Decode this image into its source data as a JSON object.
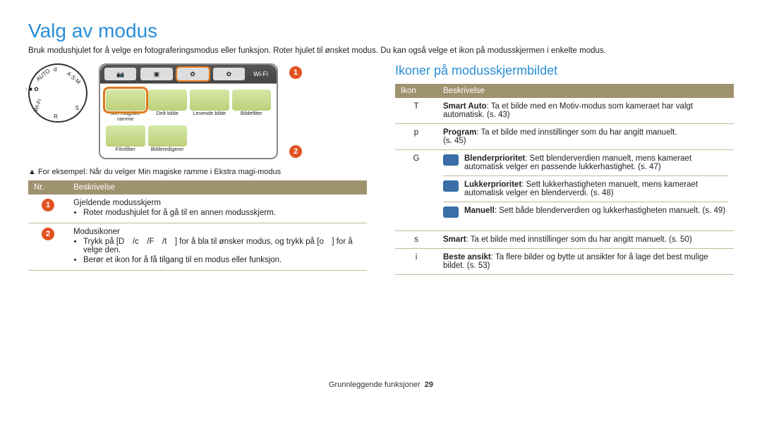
{
  "page": {
    "title": "Valg av modus",
    "intro": "Bruk modushjulet for å velge en fotograferingsmodus eller funksjon. Roter hjulet til ønsket modus. Du kan også velge et ikon på modusskjermen i enkelte modus.",
    "example": "▲ For eksempel: Når du velger Min magiske ramme i Ekstra magi-modus",
    "footer_section": "Grunnleggende funksjoner",
    "footer_page": "29"
  },
  "mode_panel": {
    "wifi": "Wi-Fi",
    "thumbs": [
      {
        "label": "Min magiske ramme",
        "selected": true
      },
      {
        "label": "Delt bilde"
      },
      {
        "label": "Levende bilde"
      },
      {
        "label": "Bildefilter"
      },
      {
        "label": "Filmfilter"
      },
      {
        "label": "Bilderedigerer"
      }
    ]
  },
  "callouts": {
    "c1": "1",
    "c2": "2"
  },
  "left_table": {
    "h_nr": "Nr.",
    "h_desc": "Beskrivelse",
    "rows": [
      {
        "nr": "1",
        "title": "Gjeldende modusskjerm",
        "bullets": [
          "Roter modushjulet for å gå til en annen modusskjerm."
        ]
      },
      {
        "nr": "2",
        "title": "Modusikoner",
        "bullets": [
          "Trykk på [D /c /F /t ] for å bla til ønsker modus, og trykk på [o ] for å velge den.",
          "Berør et ikon for å få tilgang til en modus eller funksjon."
        ]
      }
    ]
  },
  "right_section": {
    "heading": "Ikoner på modusskjermbildet",
    "h_icon": "Ikon",
    "h_desc": "Beskrivelse",
    "rows": [
      {
        "icon": "T",
        "text_label": "Smart Auto",
        "text_body": ": Ta et bilde med en Motiv-modus som kameraet har valgt automatisk. (s. 43)"
      },
      {
        "icon": "p",
        "text_label": "Program",
        "text_body": ": Ta et bilde med innstillinger som du har angitt manuelt."
      },
      {
        "icon": "p_ref",
        "text_body": "(s. 45)"
      },
      {
        "icon": "G",
        "sub": [
          {
            "label": "Blenderprioritet",
            "body": ": Sett blenderverdien manuelt, mens kameraet automatisk velger en passende lukkerhastighet. (s. 47)"
          },
          {
            "label": "Lukkerprioritet",
            "body": ": Sett lukkerhastigheten manuelt, mens kameraet automatisk velger en blenderverdi. (s. 48)"
          },
          {
            "label": "Manuell",
            "body": ": Sett både blenderverdien og lukkerhastigheten manuelt. (s. 49)"
          }
        ]
      },
      {
        "icon": "s",
        "text_label": "Smart",
        "text_body": ": Ta et bilde med innstillinger som du har angitt manuelt. (s. 50)"
      },
      {
        "icon": "i",
        "text_label": "Beste ansikt",
        "text_body": ": Ta flere bilder og bytte ut ansikter for å lage det best mulige bildet. (s. 53)"
      }
    ]
  }
}
